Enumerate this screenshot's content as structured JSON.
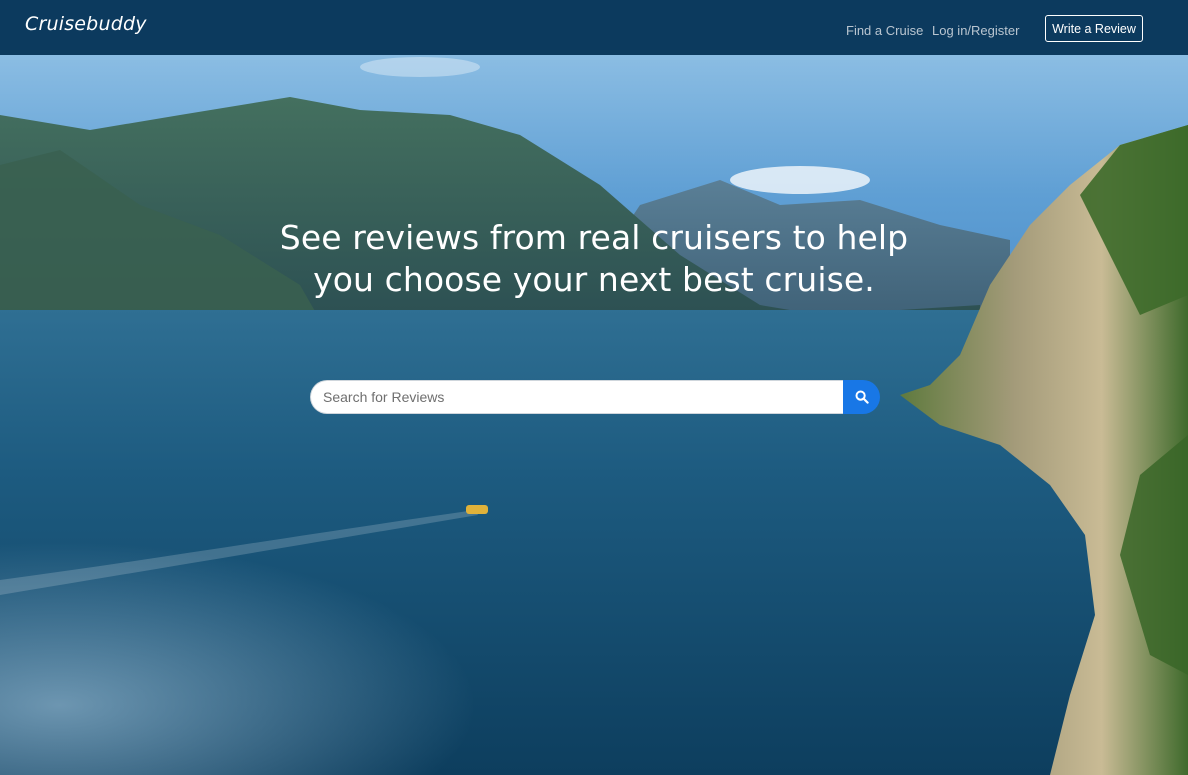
{
  "navbar": {
    "brand": "Cruisebuddy",
    "find_cruise": "Find a Cruise",
    "login_register": "Log in/Register",
    "write_review": "Write a Review"
  },
  "hero": {
    "headline_line1": "See reviews from real cruisers to help",
    "headline_line2": "you choose your next best cruise.",
    "background": "photo of a mountain lake with a speedboat and cliffs"
  },
  "search": {
    "placeholder": "Search for Reviews",
    "value": "",
    "button_icon": "search-icon"
  },
  "colors": {
    "navbar_bg": "#0c3a5e",
    "search_button": "#1877e6",
    "nav_link": "#b9c5d0",
    "white": "#ffffff"
  }
}
